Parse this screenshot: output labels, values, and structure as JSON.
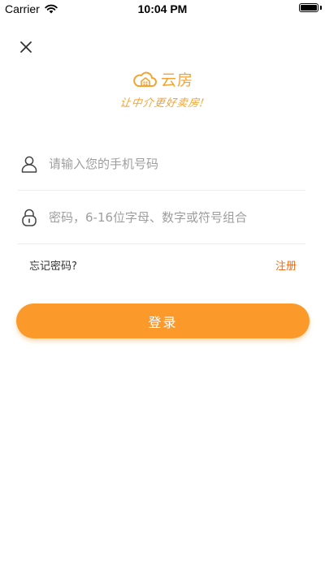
{
  "status_bar": {
    "carrier": "Carrier",
    "time": "10:04 PM",
    "wifi_icon": "wifi-icon",
    "battery_icon": "battery-icon"
  },
  "header": {
    "close_icon": "close-icon"
  },
  "logo": {
    "name": "云房",
    "slogan": "让中介更好卖房!",
    "icon": "cloud-house-icon",
    "color": "#f3a332"
  },
  "form": {
    "phone": {
      "icon": "user-icon",
      "value": "",
      "placeholder": "请输入您的手机号码"
    },
    "password": {
      "icon": "lock-icon",
      "value": "",
      "placeholder": "密码，6-16位字母、数字或符号组合"
    }
  },
  "links": {
    "forgot_password": "忘记密码?",
    "register": "注册"
  },
  "login_button": {
    "label": "登录"
  },
  "colors": {
    "accent": "#fb9a2b",
    "link_accent": "#ee6a1c",
    "placeholder": "#9e9e9e"
  }
}
